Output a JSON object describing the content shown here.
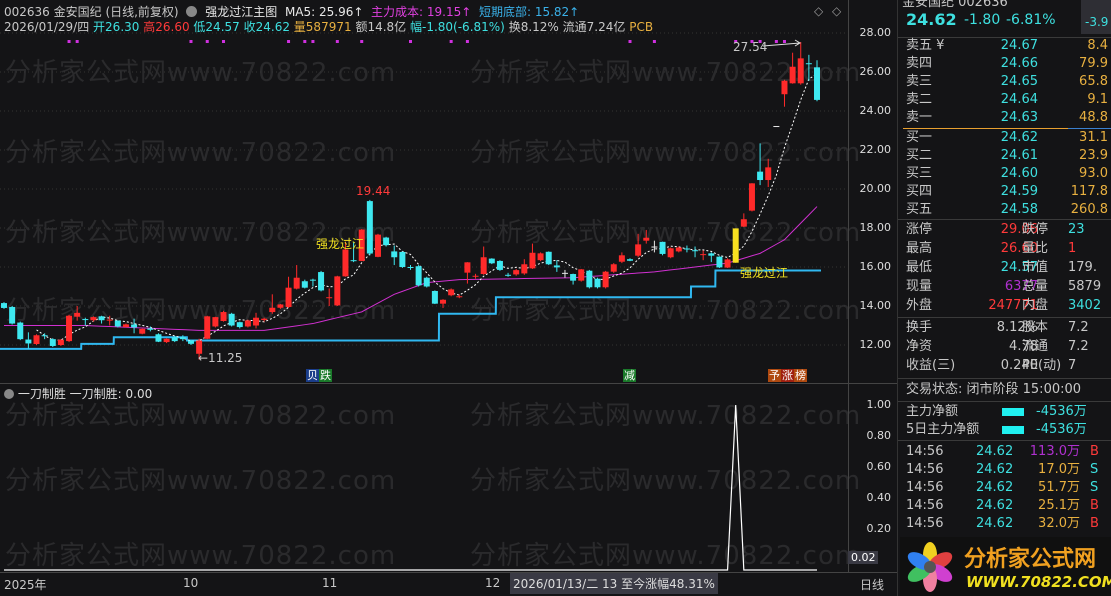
{
  "watermark": "分析家公式网www.70822.com",
  "header": {
    "code_name": "002636 金安国纪 (日线,前复权)",
    "indicator": "强龙过江主图",
    "ma5": "MA5: 25.96↑",
    "cost": "主力成本: 19.15↑",
    "bottom": "短期底部: 15.82↑",
    "date": "2026/01/29/四",
    "open": "开26.30",
    "high": "高26.60",
    "low": "低24.57",
    "close": "收24.62",
    "vol": "量587971",
    "amount": "额14.8亿",
    "change": "幅-1.80(-6.81%)",
    "turnover": "换8.12%",
    "float": "流通7.24亿",
    "sector": "PCB"
  },
  "main_annotations": {
    "peak": "19.44",
    "trough": "←11.25",
    "high_recent": "27.54",
    "signal1": "强龙过江",
    "signal2": "强龙过江",
    "tag1a": "贝",
    "tag1b": "跌",
    "tag2": "减",
    "tag3a": "予",
    "tag3b": "涨",
    "tag3c": "榜"
  },
  "price_axis": [
    "28.00",
    "26.00",
    "24.00",
    "22.00",
    "20.00",
    "18.00",
    "16.00",
    "14.00",
    "12.00"
  ],
  "sub": {
    "title": "一刀制胜 一刀制胜: 0.00",
    "axis": [
      "1.00",
      "0.80",
      "0.60",
      "0.40",
      "0.20"
    ],
    "current": "0.02"
  },
  "time_axis": {
    "labels": [
      "2025年",
      "10",
      "11",
      "12"
    ],
    "cursor_info": "2026/01/13/二 13 至今涨幅48.31%",
    "period": "日线"
  },
  "chart_data": {
    "type": "candlestick",
    "ylim": [
      12,
      28
    ],
    "candles": [
      [
        14.15,
        13.9,
        14.2,
        13.85
      ],
      [
        13.95,
        13.1,
        14.0,
        13.05
      ],
      [
        13.15,
        12.3,
        13.2,
        12.25
      ],
      [
        12.28,
        12.08,
        12.65,
        11.8
      ],
      [
        12.05,
        12.5,
        12.55,
        12.0
      ],
      [
        12.5,
        12.45,
        12.6,
        12.3
      ],
      [
        12.3,
        11.95,
        12.35,
        11.9
      ],
      [
        12.0,
        12.27,
        12.3,
        11.95
      ],
      [
        12.2,
        13.5,
        13.55,
        12.15
      ],
      [
        13.45,
        13.65,
        14.0,
        13.25
      ],
      [
        13.33,
        13.28,
        13.4,
        13.0
      ],
      [
        13.27,
        13.43,
        13.47,
        13.2
      ],
      [
        13.47,
        13.27,
        13.5,
        13.1
      ],
      [
        13.27,
        13.3,
        13.5,
        13.0
      ],
      [
        13.25,
        12.95,
        13.27,
        12.9
      ],
      [
        12.92,
        13.06,
        13.1,
        12.9
      ],
      [
        13.05,
        12.9,
        13.35,
        12.6
      ],
      [
        12.58,
        12.83,
        12.85,
        12.55
      ],
      [
        12.85,
        12.78,
        12.95,
        12.7
      ],
      [
        12.55,
        12.17,
        12.6,
        12.15
      ],
      [
        12.15,
        12.32,
        12.35,
        12.1
      ],
      [
        12.4,
        12.2,
        12.45,
        12.15
      ],
      [
        12.4,
        12.3,
        12.5,
        12.2
      ],
      [
        12.23,
        12.06,
        12.25,
        12.0
      ],
      [
        11.55,
        12.23,
        12.32,
        11.25
      ],
      [
        12.32,
        13.47,
        13.5,
        12.3
      ],
      [
        12.95,
        13.43,
        13.45,
        12.9
      ],
      [
        13.23,
        13.69,
        13.75,
        13.2
      ],
      [
        13.6,
        13.0,
        13.65,
        12.95
      ],
      [
        13.17,
        12.92,
        13.2,
        12.85
      ],
      [
        12.95,
        13.26,
        13.3,
        12.9
      ],
      [
        13.0,
        13.4,
        13.65,
        12.85
      ],
      [
        13.28,
        13.35,
        13.4,
        13.2
      ],
      [
        13.69,
        13.91,
        14.6,
        13.6
      ],
      [
        13.91,
        14.08,
        14.1,
        13.85
      ],
      [
        13.95,
        14.94,
        15.5,
        13.9
      ],
      [
        14.89,
        15.45,
        16.1,
        14.85
      ],
      [
        15.27,
        14.94,
        15.35,
        14.9
      ],
      [
        15.35,
        15.3,
        15.4,
        15.0
      ],
      [
        15.74,
        14.8,
        15.8,
        14.75
      ],
      [
        14.4,
        14.45,
        14.9,
        14.0
      ],
      [
        14.03,
        15.52,
        15.55,
        14.0
      ],
      [
        15.52,
        16.9,
        17.3,
        15.5
      ],
      [
        16.35,
        16.31,
        17.3,
        16.25
      ],
      [
        16.31,
        17.92,
        17.95,
        16.3
      ],
      [
        19.38,
        16.69,
        19.44,
        16.6
      ],
      [
        16.52,
        17.66,
        17.7,
        16.5
      ],
      [
        17.51,
        17.12,
        17.55,
        17.05
      ],
      [
        16.8,
        16.5,
        17.1,
        16.1
      ],
      [
        16.77,
        16.0,
        16.8,
        15.95
      ],
      [
        16.0,
        15.95,
        16.1,
        15.85
      ],
      [
        16.04,
        15.06,
        16.1,
        15.0
      ],
      [
        15.45,
        15.0,
        15.5,
        14.95
      ],
      [
        14.77,
        14.12,
        14.8,
        14.1
      ],
      [
        14.12,
        14.32,
        14.35,
        13.9
      ],
      [
        14.55,
        14.85,
        14.9,
        14.5
      ],
      [
        14.45,
        14.5,
        14.6,
        14.4
      ],
      [
        15.71,
        16.24,
        16.25,
        15.15
      ],
      [
        15.5,
        15.55,
        15.65,
        15.4
      ],
      [
        15.64,
        16.5,
        17.05,
        15.6
      ],
      [
        16.43,
        16.19,
        16.45,
        16.15
      ],
      [
        16.31,
        15.85,
        16.35,
        15.8
      ],
      [
        15.6,
        15.55,
        15.7,
        15.5
      ],
      [
        15.62,
        15.84,
        15.9,
        15.55
      ],
      [
        15.67,
        16.14,
        16.4,
        15.6
      ],
      [
        15.93,
        16.73,
        17.2,
        15.9
      ],
      [
        16.35,
        16.7,
        16.75,
        16.3
      ],
      [
        16.78,
        16.14,
        16.8,
        16.1
      ],
      [
        16.08,
        15.98,
        16.35,
        15.75
      ],
      [
        15.7,
        15.7,
        15.85,
        15.45
      ],
      [
        15.64,
        15.3,
        15.66,
        15.1
      ],
      [
        15.3,
        15.88,
        15.9,
        15.25
      ],
      [
        15.81,
        14.96,
        15.85,
        14.9
      ],
      [
        15.4,
        14.96,
        15.45,
        14.9
      ],
      [
        14.96,
        15.76,
        15.8,
        14.9
      ],
      [
        15.76,
        16.14,
        16.2,
        15.7
      ],
      [
        16.27,
        16.6,
        16.75,
        16.2
      ],
      [
        16.4,
        16.32,
        16.45,
        16.3
      ],
      [
        16.58,
        17.16,
        17.7,
        16.5
      ],
      [
        17.35,
        17.5,
        17.9,
        17.2
      ],
      [
        17.05,
        17.05,
        17.35,
        16.75
      ],
      [
        17.29,
        16.67,
        17.3,
        16.6
      ],
      [
        16.5,
        16.96,
        17.0,
        16.45
      ],
      [
        16.8,
        17.0,
        17.05,
        16.75
      ],
      [
        16.95,
        16.93,
        17.1,
        16.75
      ],
      [
        16.86,
        16.83,
        17.05,
        16.5
      ],
      [
        16.63,
        16.66,
        16.85,
        16.35
      ],
      [
        16.7,
        16.58,
        16.75,
        16.25
      ],
      [
        16.53,
        15.98,
        16.55,
        15.95
      ],
      [
        15.97,
        16.39,
        16.45,
        15.95
      ],
      [
        16.22,
        17.98,
        17.98,
        16.22
      ],
      [
        18.07,
        18.45,
        18.75,
        18.05
      ],
      [
        18.89,
        20.29,
        20.3,
        18.85
      ],
      [
        20.89,
        20.46,
        22.34,
        20.2
      ],
      [
        20.46,
        21.11,
        21.55,
        20.1
      ],
      [
        23.23,
        23.23,
        23.23,
        23.23
      ],
      [
        24.86,
        25.55,
        25.6,
        24.22
      ],
      [
        25.42,
        26.27,
        26.99,
        25.4
      ],
      [
        25.42,
        26.7,
        27.54,
        25.35
      ],
      [
        26.45,
        26.44,
        26.88,
        25.55
      ],
      [
        26.24,
        24.57,
        26.6,
        24.5
      ]
    ],
    "highlight_index": 90,
    "cost_line": [
      [
        0,
        13.0
      ],
      [
        10,
        13.0
      ],
      [
        24,
        12.75
      ],
      [
        32,
        12.75
      ],
      [
        38,
        13.1
      ],
      [
        44,
        13.7
      ],
      [
        48,
        14.6
      ],
      [
        52,
        15.2
      ],
      [
        56,
        15.35
      ],
      [
        70,
        15.45
      ],
      [
        80,
        15.75
      ],
      [
        89,
        16.2
      ],
      [
        93,
        16.7
      ],
      [
        96,
        17.4
      ],
      [
        100,
        19.1
      ]
    ],
    "bottom_line": [
      [
        0,
        11.8
      ],
      [
        10,
        12.06
      ],
      [
        14,
        12.4
      ],
      [
        23,
        12.23
      ],
      [
        54,
        13.6
      ],
      [
        61,
        14.45
      ],
      [
        85,
        15.0
      ],
      [
        88,
        15.82
      ],
      [
        100,
        15.82
      ]
    ],
    "signal_dots": [
      8,
      9,
      23,
      25,
      27,
      35,
      37,
      38,
      41,
      44,
      50,
      55,
      57,
      77,
      80,
      90,
      92,
      93,
      95,
      96
    ],
    "sub_values": {
      "90": 1.0
    }
  },
  "quote": {
    "title": "金安国纪 002636",
    "price": "24.62",
    "change": "-1.80",
    "pct": "-6.81%",
    "side": "-3.9"
  },
  "asks": [
    {
      "l": "卖五 ¥",
      "p": "24.67",
      "v": "8.4"
    },
    {
      "l": "卖四",
      "p": "24.66",
      "v": "79.9"
    },
    {
      "l": "卖三",
      "p": "24.65",
      "v": "65.8"
    },
    {
      "l": "卖二",
      "p": "24.64",
      "v": "9.1"
    },
    {
      "l": "卖一",
      "p": "24.63",
      "v": "48.8"
    }
  ],
  "bids": [
    {
      "l": "买一",
      "p": "24.62",
      "v": "31.1"
    },
    {
      "l": "买二",
      "p": "24.61",
      "v": "23.9"
    },
    {
      "l": "买三",
      "p": "24.60",
      "v": "93.0"
    },
    {
      "l": "买四",
      "p": "24.59",
      "v": "117.8"
    },
    {
      "l": "买五",
      "p": "24.58",
      "v": "260.8"
    }
  ],
  "stats": [
    {
      "l1": "涨停",
      "v1": "29.06",
      "l2": "跌停",
      "v2": "23"
    },
    {
      "l1": "最高",
      "v1": "26.60",
      "l2": "量比",
      "v2": "1"
    },
    {
      "l1": "最低",
      "v1": "24.57",
      "l2": "市值",
      "v2": "179."
    },
    {
      "l1": "现量",
      "v1": "6377",
      "l2": "总量",
      "v2": "5879"
    },
    {
      "l1": "外盘",
      "v1": "247771",
      "l2": "内盘",
      "v2": "3402"
    }
  ],
  "fin": [
    {
      "l1": "换手",
      "v1": "8.12%",
      "l2": "股本",
      "v2": "7.2"
    },
    {
      "l1": "净资",
      "v1": "4.78",
      "l2": "流通",
      "v2": "7.2"
    },
    {
      "l1": "收益(三)",
      "v1": "0.240",
      "l2": "PE(动)",
      "v2": "7"
    }
  ],
  "status": "交易状态: 闭市阶段 15:00:00",
  "flows": [
    {
      "l": "主力净额",
      "v": "-4536万"
    },
    {
      "l": "5日主力净额",
      "v": "-4536万"
    }
  ],
  "trades": [
    {
      "t": "14:56",
      "p": "24.62",
      "v": "113.0万",
      "s": "B"
    },
    {
      "t": "14:56",
      "p": "24.62",
      "v": "17.0万",
      "s": "S"
    },
    {
      "t": "14:56",
      "p": "24.62",
      "v": "51.7万",
      "s": "S"
    },
    {
      "t": "14:56",
      "p": "24.62",
      "v": "25.1万",
      "s": "B"
    },
    {
      "t": "14:56",
      "p": "24.62",
      "v": "32.0万",
      "s": "B"
    }
  ],
  "logo": {
    "name": "分析家公式网",
    "url": "WWW.70822.COM"
  }
}
